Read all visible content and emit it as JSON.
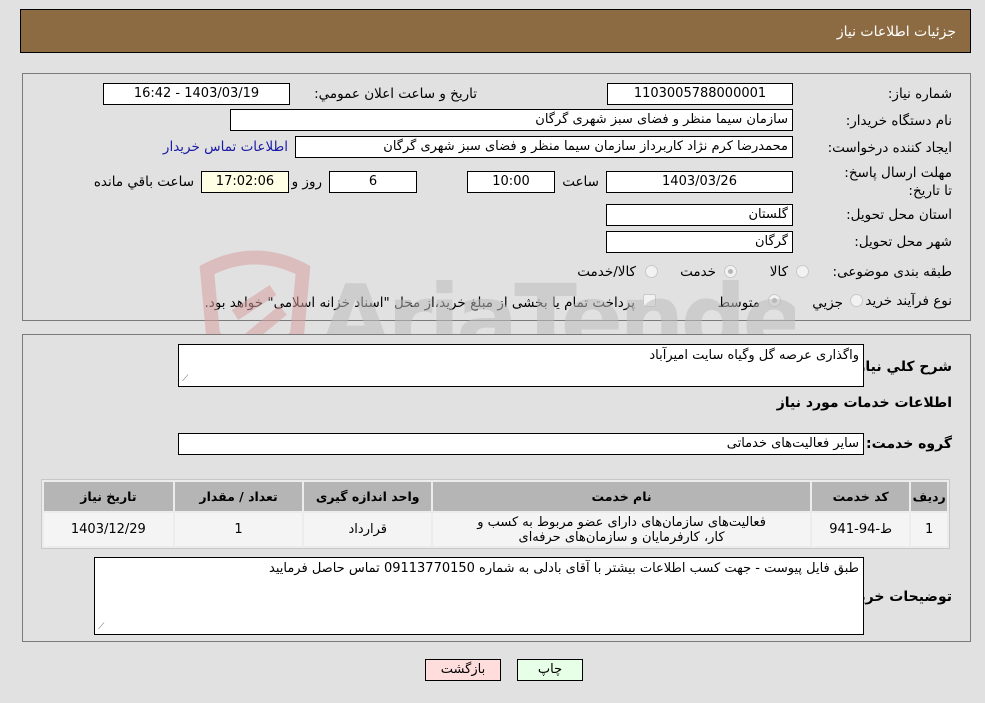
{
  "header": {
    "title": "جزئیات اطلاعات نیاز"
  },
  "info": {
    "need_number_label": "شماره نیاز:",
    "need_number": "1103005788000001",
    "announce_label": "تاريخ و ساعت اعلان عمومي:",
    "announce_value": "1403/03/19 - 16:42",
    "buyer_org_label": "نام دستگاه خريدار:",
    "buyer_org": "سازمان سيما  منظر و فضای سبز شهری گرگان",
    "creator_label": "ايجاد کننده درخواست:",
    "creator": "محمدرضا کرم نژاد کاربرداز سازمان سيما  منظر و فضای سبز شهری گرگان",
    "contact_link": "اطلاعات تماس خريدار",
    "deadline_label": "مهلت ارسال پاسخ: تا تاریخ:",
    "deadline_date": "1403/03/26",
    "time_label": "ساعت",
    "deadline_time": "10:00",
    "days_value": "6",
    "days_label": "روز و",
    "remaining_time": "17:02:06",
    "remaining_label": "ساعت باقي مانده",
    "province_label": "استان محل تحویل:",
    "province": "گلستان",
    "city_label": "شهر محل تحویل:",
    "city": "گرگان",
    "category_label": "طبقه بندی موضوعی:",
    "category_options": [
      {
        "label": "کالا",
        "checked": false
      },
      {
        "label": "خدمت",
        "checked": true
      },
      {
        "label": "کالا/خدمت",
        "checked": false
      }
    ],
    "process_label": "نوع فرآیند خرید :",
    "process_options": [
      {
        "label": "جزيي",
        "checked": false
      },
      {
        "label": "متوسط",
        "checked": true
      }
    ],
    "treasury_note": "پرداخت تمام يا بخشی از مبلغ خريد،از محل \"اسناد خزانه اسلامی\" خواهد بود."
  },
  "details": {
    "description_label": "شرح کلي نياز:",
    "description": "واگذاری عرصه گل وگیاه سایت امیرآباد",
    "services_heading": "اطلاعات خدمات مورد نیاز",
    "service_group_label": "گروه خدمت:",
    "service_group": "سایر فعالیت‌های خدماتی",
    "table": {
      "headers": [
        "رديف",
        "کد خدمت",
        "نام خدمت",
        "واحد اندازه گيری",
        "تعداد / مقدار",
        "تاريخ نياز"
      ],
      "rows": [
        [
          "1",
          "ط-94-941",
          "فعالیت‌های سازمان‌های دارای عضو مربوط به کسب و کار، کارفرمایان و سازمان‌های حرفه‌ای",
          "قرارداد",
          "1",
          "1403/12/29"
        ]
      ]
    },
    "buyer_notes_label": "توضيحات خريدار:",
    "buyer_notes": "طبق فایل پیوست - جهت کسب اطلاعات بیشتر با آقای بادلی به شماره 09113770150 تماس حاصل فرمایید"
  },
  "buttons": {
    "print": "چاپ",
    "back": "بازگشت"
  },
  "watermark": {
    "text": "AriaTender.neT"
  }
}
